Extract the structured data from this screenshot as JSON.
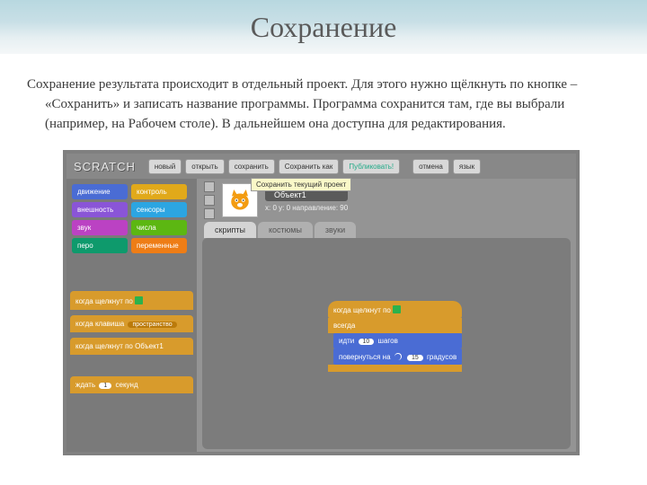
{
  "slide": {
    "title": "Сохранение",
    "paragraph": "Сохранение результата происходит в отдельный проект. Для этого нужно щёлкнуть по кнопке – «Сохранить» и записать название программы. Программа сохранится там, где вы выбрали (например, на Рабочем столе). В дальнейшем она доступна для редактирования."
  },
  "scratch": {
    "logo": "SCRATCH",
    "toolbar": {
      "new": "новый",
      "open": "открыть",
      "save": "сохранить",
      "saveAs": "Сохранить как",
      "publish": "Публиковать!",
      "cancel": "отмена",
      "lang": "язык"
    },
    "tooltip": "Сохранить текущий проект",
    "categories": {
      "motion": "движение",
      "control": "контроль",
      "looks": "внешность",
      "sensing": "сенсоры",
      "sound": "звук",
      "operators": "числа",
      "pen": "перо",
      "variables": "переменные"
    },
    "paletteBlocks": {
      "whenFlag": "когда щелкнут по",
      "whenKey": "когда клавиша",
      "keySlot": "пространство",
      "whenSprite": "когда щелкнут по  Объект1",
      "wait": "ждать",
      "waitN": "1",
      "waitUnit": "секунд"
    },
    "sprite": {
      "name": "Объект1",
      "coords": "x: 0    y: 0    направление: 90"
    },
    "tabs": {
      "scripts": "скрипты",
      "costumes": "костюмы",
      "sounds": "звуки"
    },
    "script": {
      "hat": "когда щелкнут по",
      "forever": "всегда",
      "move1": "идти",
      "moveN": "10",
      "move2": "шагов",
      "turn1": "повернуться на",
      "turnN": "15",
      "turn2": "градусов"
    }
  }
}
